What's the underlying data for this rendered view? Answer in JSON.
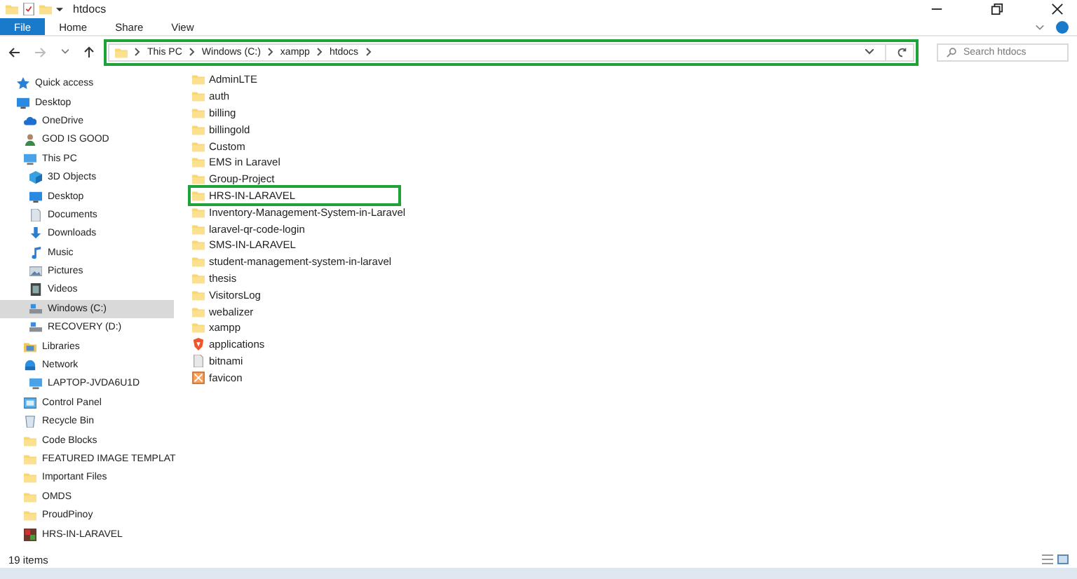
{
  "window": {
    "title": "htdocs"
  },
  "ribbon_tabs": [
    {
      "label": "File",
      "selected": true
    },
    {
      "label": "Home",
      "selected": false
    },
    {
      "label": "Share",
      "selected": false
    },
    {
      "label": "View",
      "selected": false
    }
  ],
  "address_bar": {
    "highlighted": true,
    "path": [
      "This PC",
      "Windows (C:)",
      "xampp",
      "htdocs"
    ]
  },
  "search": {
    "placeholder": "Search htdocs"
  },
  "sidebar": {
    "items": [
      {
        "label": "Quick access",
        "kind": "star",
        "selected": false
      },
      {
        "label": "Desktop",
        "kind": "desktop",
        "selected": false,
        "children": [
          {
            "label": "OneDrive",
            "kind": "cloud",
            "selected": false
          },
          {
            "label": "GOD IS GOOD",
            "kind": "user",
            "selected": false
          },
          {
            "label": "This PC",
            "kind": "pc",
            "selected": false,
            "children": [
              {
                "label": "3D Objects",
                "kind": "cube",
                "selected": false
              },
              {
                "label": "Desktop",
                "kind": "desktop",
                "selected": false
              },
              {
                "label": "Documents",
                "kind": "document",
                "selected": false
              },
              {
                "label": "Downloads",
                "kind": "download",
                "selected": false
              },
              {
                "label": "Music",
                "kind": "music",
                "selected": false
              },
              {
                "label": "Pictures",
                "kind": "picture",
                "selected": false
              },
              {
                "label": "Videos",
                "kind": "video",
                "selected": false
              },
              {
                "label": "Windows (C:)",
                "kind": "drive",
                "selected": true
              },
              {
                "label": "RECOVERY (D:)",
                "kind": "drive",
                "selected": false
              }
            ]
          },
          {
            "label": "Libraries",
            "kind": "library",
            "selected": false
          },
          {
            "label": "Network",
            "kind": "network",
            "selected": false,
            "children": [
              {
                "label": "LAPTOP-JVDA6U1D",
                "kind": "pc",
                "selected": false
              }
            ]
          },
          {
            "label": "Control Panel",
            "kind": "control",
            "selected": false
          },
          {
            "label": "Recycle Bin",
            "kind": "bin",
            "selected": false
          },
          {
            "label": "Code Blocks",
            "kind": "folder",
            "selected": false
          },
          {
            "label": "FEATURED IMAGE TEMPLAT",
            "kind": "folder",
            "selected": false
          },
          {
            "label": "Important Files",
            "kind": "folder",
            "selected": false
          },
          {
            "label": "OMDS",
            "kind": "folder",
            "selected": false
          },
          {
            "label": "ProudPinoy",
            "kind": "folder",
            "selected": false
          },
          {
            "label": "HRS-IN-LARAVEL",
            "kind": "app",
            "selected": false
          }
        ]
      }
    ]
  },
  "files": [
    {
      "name": "AdminLTE",
      "kind": "folder",
      "highlighted": false
    },
    {
      "name": "auth",
      "kind": "folder",
      "highlighted": false
    },
    {
      "name": "billing",
      "kind": "folder",
      "highlighted": false
    },
    {
      "name": "billingold",
      "kind": "folder",
      "highlighted": false
    },
    {
      "name": "Custom",
      "kind": "folder",
      "highlighted": false
    },
    {
      "name": "EMS in Laravel",
      "kind": "folder",
      "highlighted": false
    },
    {
      "name": "Group-Project",
      "kind": "folder",
      "highlighted": false
    },
    {
      "name": "HRS-IN-LARAVEL",
      "kind": "folder",
      "highlighted": true
    },
    {
      "name": "Inventory-Management-System-in-Laravel",
      "kind": "folder",
      "highlighted": false
    },
    {
      "name": "laravel-qr-code-login",
      "kind": "folder",
      "highlighted": false
    },
    {
      "name": "SMS-IN-LARAVEL",
      "kind": "folder",
      "highlighted": false
    },
    {
      "name": "student-management-system-in-laravel",
      "kind": "folder",
      "highlighted": false
    },
    {
      "name": "thesis",
      "kind": "folder",
      "highlighted": false
    },
    {
      "name": "VisitorsLog",
      "kind": "folder",
      "highlighted": false
    },
    {
      "name": "webalizer",
      "kind": "folder",
      "highlighted": false
    },
    {
      "name": "xampp",
      "kind": "folder",
      "highlighted": false
    },
    {
      "name": "applications",
      "kind": "browser",
      "highlighted": false
    },
    {
      "name": "bitnami",
      "kind": "file",
      "highlighted": false
    },
    {
      "name": "favicon",
      "kind": "image",
      "highlighted": false
    }
  ],
  "status_bar": {
    "count": "19 items"
  }
}
